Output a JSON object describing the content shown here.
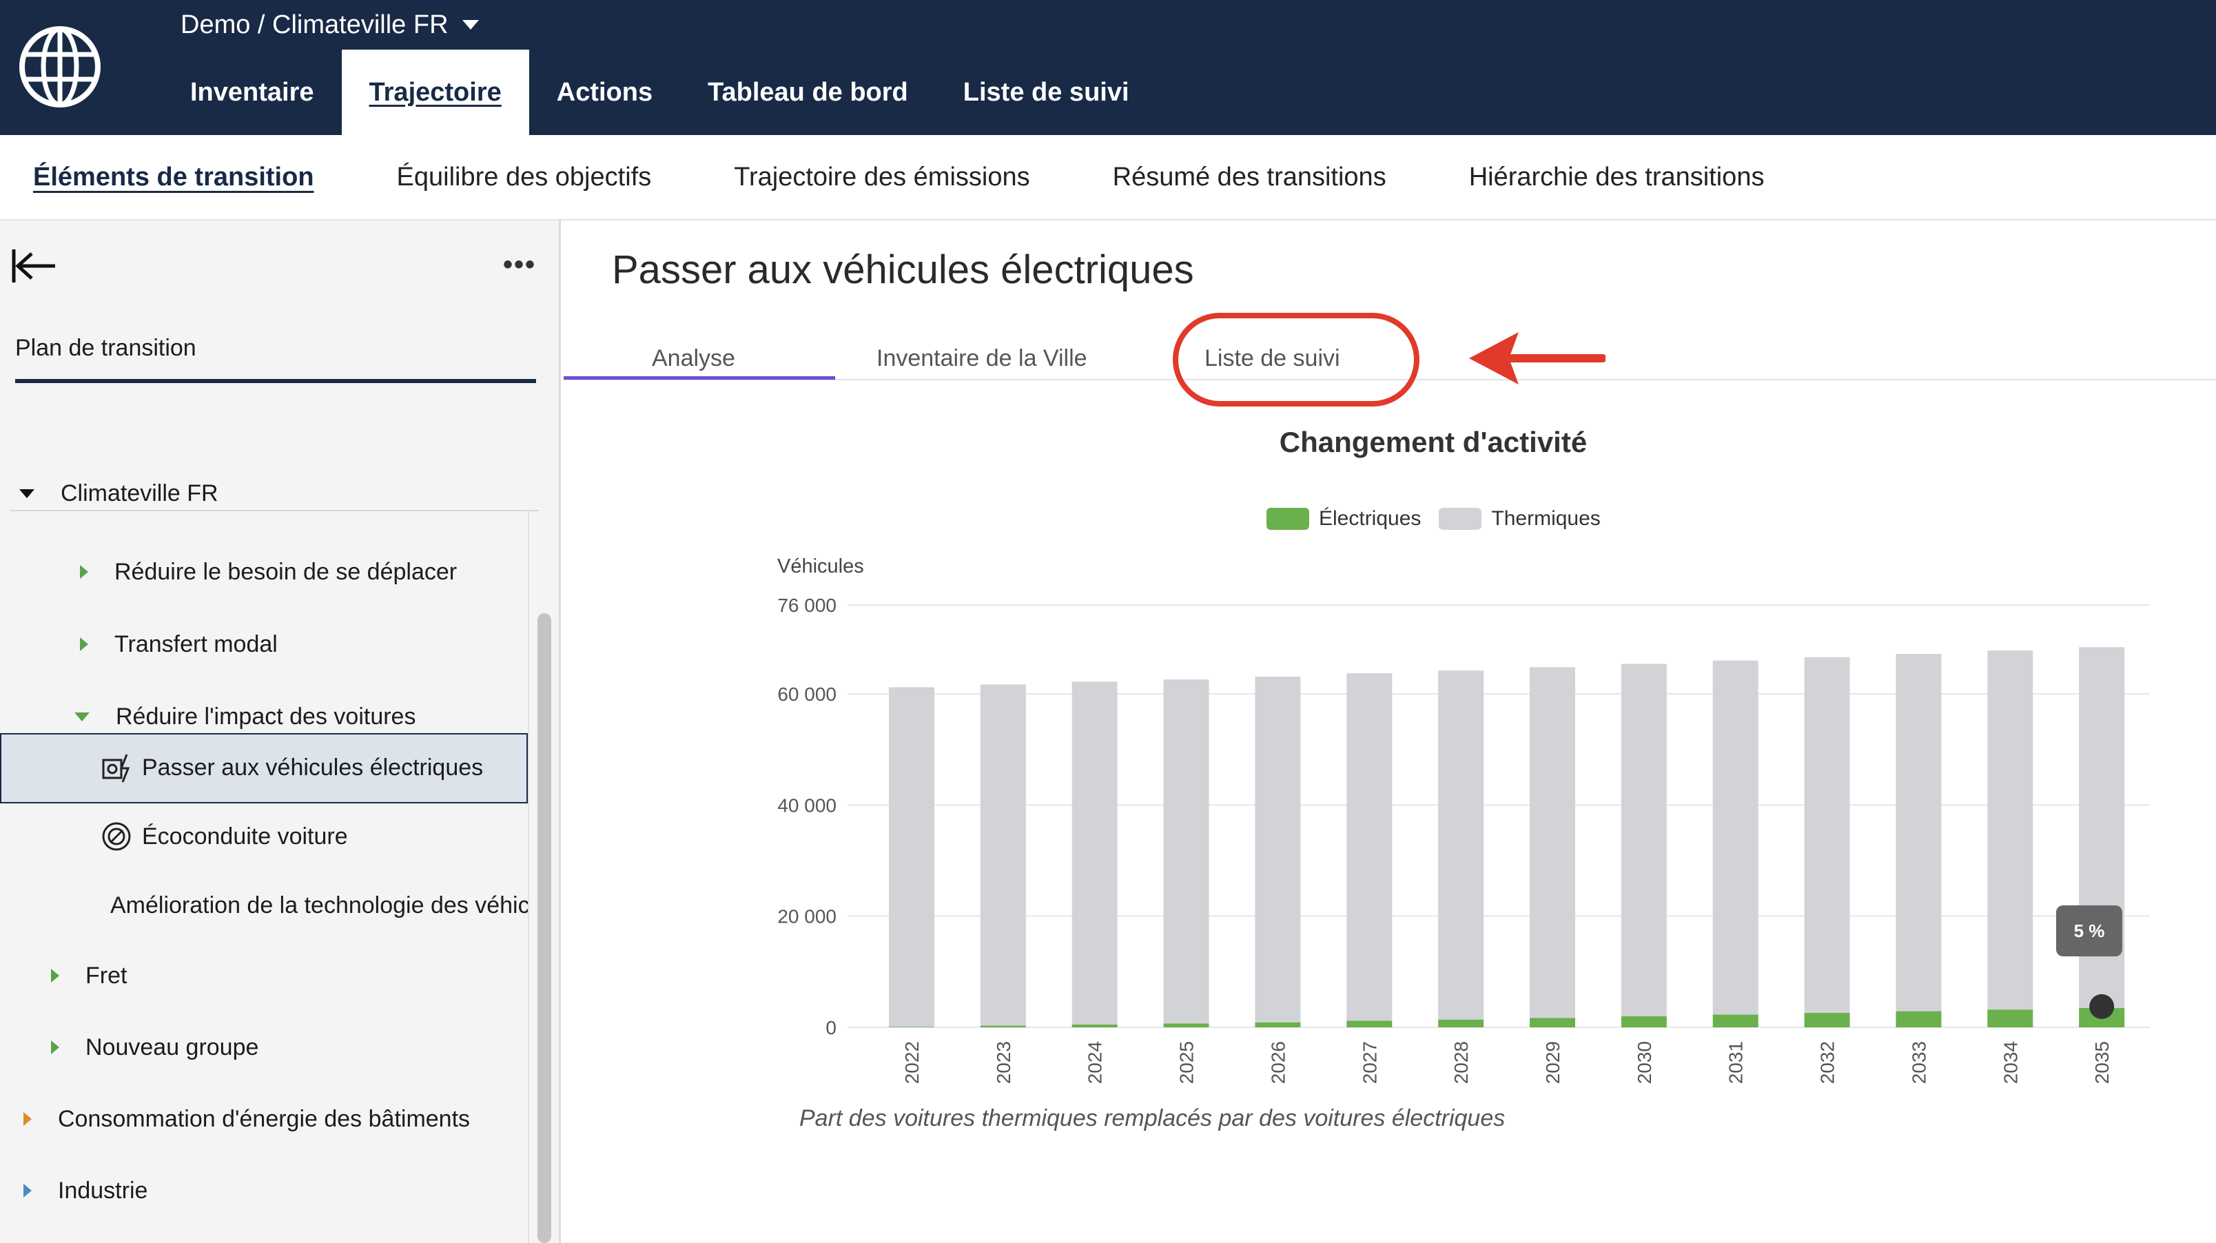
{
  "topbar": {
    "breadcrumb": "Demo / Climateville FR",
    "tabs": [
      {
        "label": "Inventaire",
        "active": false
      },
      {
        "label": "Trajectoire",
        "active": true
      },
      {
        "label": "Actions",
        "active": false
      },
      {
        "label": "Tableau de bord",
        "active": false
      },
      {
        "label": "Liste de suivi",
        "active": false
      }
    ]
  },
  "subnav": {
    "tabs": [
      {
        "label": "Éléments de transition",
        "active": true
      },
      {
        "label": "Équilibre des objectifs",
        "active": false
      },
      {
        "label": "Trajectoire des émissions",
        "active": false
      },
      {
        "label": "Résumé des transitions",
        "active": false
      },
      {
        "label": "Hiérarchie des transitions",
        "active": false
      }
    ]
  },
  "sidebar": {
    "tab_label": "Plan de transition",
    "more_label": "•••",
    "tree": {
      "root": "Climateville FR",
      "reduire_besoin": "Réduire le besoin de se déplacer",
      "transfert_modal": "Transfert modal",
      "reduire_impact": "Réduire l'impact des voitures",
      "passer_vehicules": "Passer aux véhicules électriques",
      "ecoconduite": "Écoconduite voiture",
      "amelioration": "Amélioration de la technologie des véhicules",
      "fret": "Fret",
      "nouveau_groupe": "Nouveau groupe",
      "consommation": "Consommation d'énergie des bâtiments",
      "industrie": "Industrie"
    }
  },
  "main": {
    "title": "Passer aux véhicules électriques",
    "tabs": {
      "analyse": "Analyse",
      "inventaire": "Inventaire de la Ville",
      "liste_suivi": "Liste de suivi"
    },
    "tooltip": "5 %",
    "footnote": "Part des voitures thermiques remplacés par des voitures électriques"
  },
  "colors": {
    "navy": "#182a46",
    "electric": "#6ab04c",
    "thermal": "#d2d3d6",
    "highlight_red": "#e03a2a",
    "active_tab_purple": "#6f4bd8"
  },
  "icons": {
    "logo": "globe-logo-icon",
    "collapse": "collapse-left-icon",
    "ev": "electric-vehicle-icon",
    "eco": "eco-driving-icon",
    "tech": "vehicle-technology-icon"
  },
  "chart_data": {
    "type": "bar",
    "stacked": true,
    "title": "Changement d'activité",
    "ylabel": "Véhicules",
    "ylim": [
      0,
      76000
    ],
    "yticks": [
      0,
      20000,
      40000,
      60000,
      76000
    ],
    "ytick_labels": [
      "0",
      "20 000",
      "40 000",
      "60 000",
      "76 000"
    ],
    "legend_position": "top-center",
    "categories": [
      "2022",
      "2023",
      "2024",
      "2025",
      "2026",
      "2027",
      "2028",
      "2029",
      "2030",
      "2031",
      "2032",
      "2033",
      "2034",
      "2035"
    ],
    "series": [
      {
        "name": "Électriques",
        "color": "#6ab04c",
        "values": [
          100,
          300,
          500,
          700,
          900,
          1200,
          1400,
          1700,
          2000,
          2300,
          2600,
          2900,
          3200,
          3500
        ]
      },
      {
        "name": "Thermiques",
        "color": "#d2d3d6",
        "values": [
          61100,
          61400,
          61700,
          61900,
          62200,
          62500,
          62800,
          63100,
          63400,
          63700,
          64000,
          64300,
          64600,
          64900
        ]
      }
    ]
  }
}
